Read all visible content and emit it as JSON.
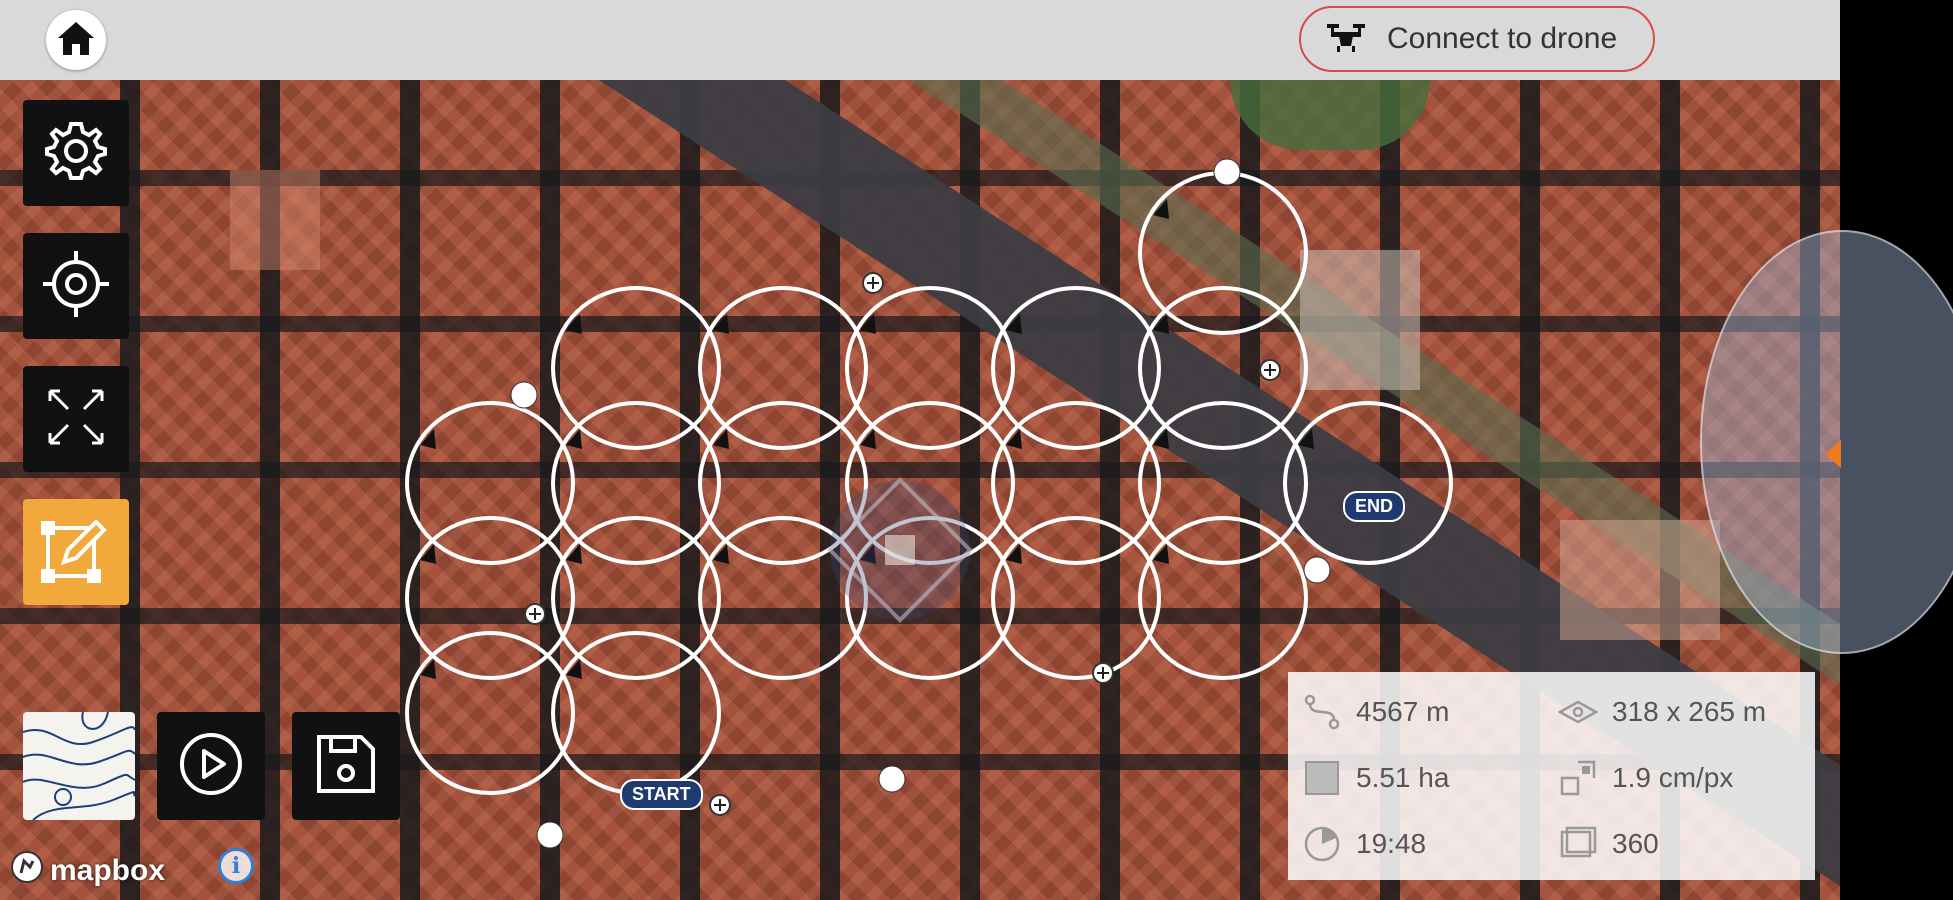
{
  "topbar": {
    "home_icon": "home-icon",
    "connect_label": "Connect to drone",
    "connect_icon": "drone-icon",
    "connect_border_color": "#d84a4a"
  },
  "sidebar": {
    "items": [
      {
        "name": "settings",
        "icon": "gear-icon"
      },
      {
        "name": "locate",
        "icon": "crosshair-icon"
      },
      {
        "name": "fit-bounds",
        "icon": "expand-arrows-icon"
      },
      {
        "name": "edit-area",
        "icon": "edit-polygon-icon",
        "active": true,
        "active_color": "#f2a93b"
      }
    ]
  },
  "bottom_tools": [
    {
      "name": "layer-style",
      "icon": "contour-map-icon"
    },
    {
      "name": "play-mission",
      "icon": "play-icon"
    },
    {
      "name": "save-mission",
      "icon": "floppy-disk-icon"
    }
  ],
  "map": {
    "attribution": "mapbox",
    "info_icon": "i",
    "start_label": "START",
    "end_label": "END",
    "compass_accent": "#f07a20"
  },
  "stats": {
    "distance": "4567 m",
    "dimensions": "318 x 265 m",
    "area": "5.51 ha",
    "resolution": "1.9 cm/px",
    "duration": "19:48",
    "photos": "360"
  }
}
